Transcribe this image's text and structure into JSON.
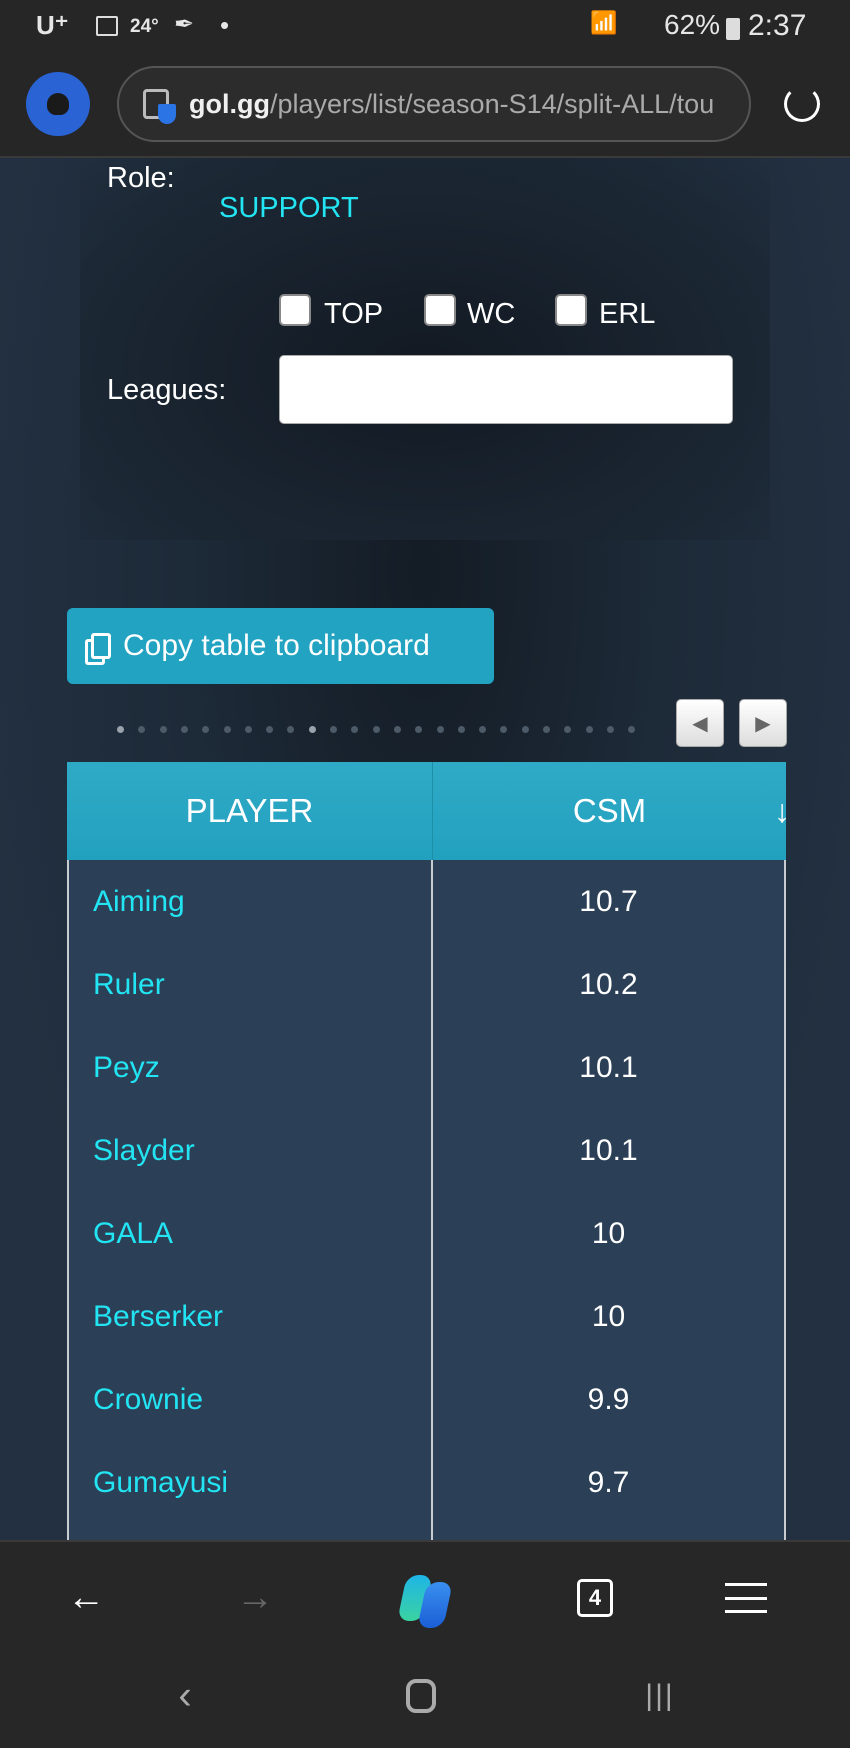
{
  "status_bar": {
    "carrier": "U⁺",
    "temperature": "24°",
    "battery": "62%",
    "time": "2:37"
  },
  "browser": {
    "url_domain": "gol.gg",
    "url_path": "/players/list/season-S14/split-ALL/tou",
    "tab_count": "4"
  },
  "filters": {
    "role_label": "Role:",
    "role_value": "SUPPORT",
    "checkboxes": [
      {
        "label": "TOP",
        "checked": false
      },
      {
        "label": "WC",
        "checked": false
      },
      {
        "label": "ERL",
        "checked": false
      }
    ],
    "leagues_label": "Leagues:",
    "leagues_value": ""
  },
  "copy_button": "Copy table to clipboard",
  "pager": {
    "dots": 25,
    "active_index": 9
  },
  "table": {
    "headers": [
      "PLAYER",
      "CSM"
    ],
    "sort_indicator": "↓",
    "rows": [
      [
        "Aiming",
        "10.7"
      ],
      [
        "Ruler",
        "10.2"
      ],
      [
        "Peyz",
        "10.1"
      ],
      [
        "Slayder",
        "10.1"
      ],
      [
        "GALA",
        "10"
      ],
      [
        "Berserker",
        "10"
      ],
      [
        "Crownie",
        "9.9"
      ],
      [
        "Gumayusi",
        "9.7"
      ],
      [
        "",
        ""
      ]
    ]
  },
  "colors": {
    "accent": "#22a3c1",
    "link": "#22e4f2",
    "background": "#223041"
  }
}
